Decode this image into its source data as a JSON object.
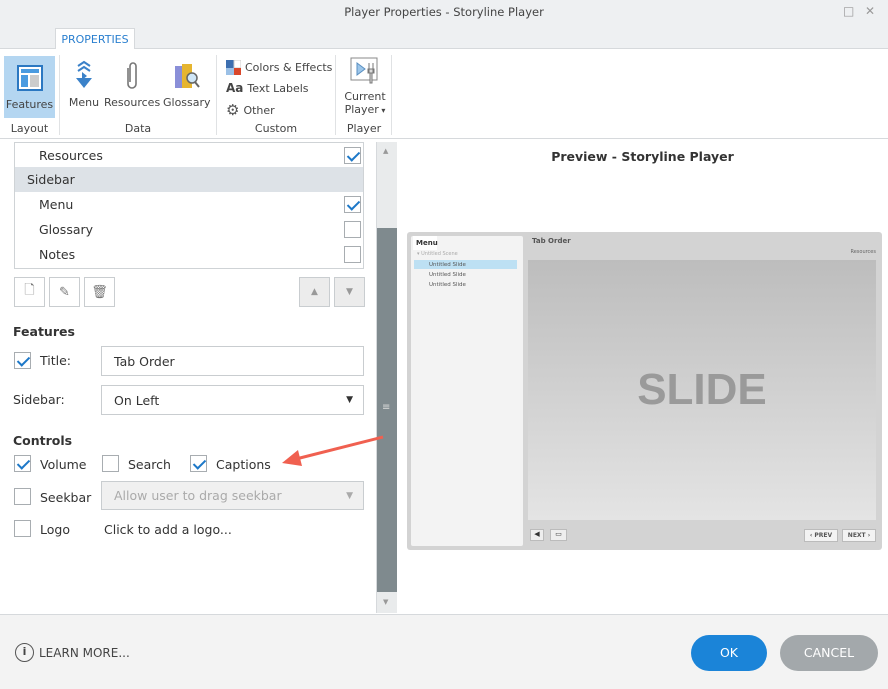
{
  "window": {
    "title": "Player Properties - Storyline Player"
  },
  "ribbon": {
    "tab": "PROPERTIES",
    "features": "Features",
    "layout_group": "Layout",
    "menu": "Menu",
    "resources": "Resources",
    "glossary": "Glossary",
    "data_group": "Data",
    "colors": "Colors & Effects",
    "text_labels": "Text Labels",
    "text_labels_icon": "Aa",
    "other": "Other",
    "custom_group": "Custom",
    "current_player_1": "Current",
    "current_player_2": "Player",
    "player_group": "Player"
  },
  "tabs_list": [
    {
      "label": "Resources",
      "checked": true
    },
    {
      "label": "Sidebar",
      "header": true
    },
    {
      "label": "Menu",
      "checked": true
    },
    {
      "label": "Glossary",
      "checked": false
    },
    {
      "label": "Notes",
      "checked": false
    }
  ],
  "features": {
    "heading": "Features",
    "title_label": "Title:",
    "title_checked": true,
    "title_value": "Tab Order",
    "sidebar_label": "Sidebar:",
    "sidebar_value": "On Left"
  },
  "controls": {
    "heading": "Controls",
    "volume": "Volume",
    "volume_checked": true,
    "search": "Search",
    "search_checked": false,
    "captions": "Captions",
    "captions_checked": true,
    "seekbar": "Seekbar",
    "seekbar_checked": false,
    "seekbar_option": "Allow user to drag seekbar",
    "logo": "Logo",
    "logo_checked": false,
    "logo_link": "Click to add a logo..."
  },
  "preview": {
    "title": "Preview - Storyline Player",
    "menu_tab": "Menu",
    "scene": "Untitled Scene",
    "slides": [
      "Untitled Slide",
      "Untitled Slide",
      "Untitled Slide"
    ],
    "player_title": "Tab Order",
    "resources": "Resources",
    "slide_text": "SLIDE",
    "prev": "‹ PREV",
    "next": "NEXT ›"
  },
  "footer": {
    "learn_more": "LEARN MORE...",
    "ok": "OK",
    "cancel": "CANCEL"
  },
  "colors": {
    "accent": "#1b84d8",
    "annotation_arrow": "#f06050"
  }
}
